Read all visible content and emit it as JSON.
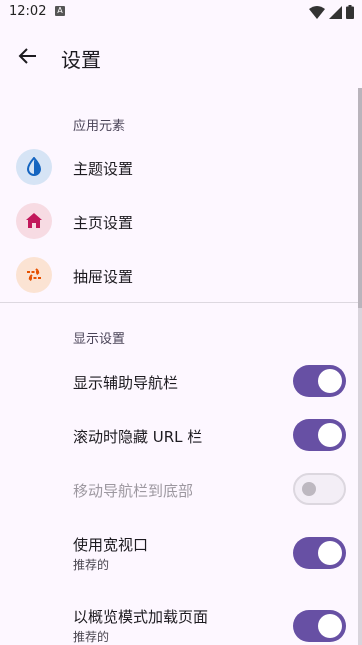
{
  "status_bar": {
    "time": "12:02",
    "notification_letter": "A",
    "icons": [
      "wifi-icon",
      "cellular-signal-icon",
      "battery-icon"
    ]
  },
  "app_bar": {
    "title": "设置",
    "back_icon": "arrow-back-icon"
  },
  "sections": [
    {
      "title": "应用元素",
      "items": [
        {
          "label": "主题设置",
          "icon": "water-drop-icon",
          "icon_color": "#1565c0",
          "icon_bg": "#d6e4f5"
        },
        {
          "label": "主页设置",
          "icon": "home-icon",
          "icon_color": "#c2185b",
          "icon_bg": "#f7dbe3"
        },
        {
          "label": "抽屉设置",
          "icon": "swap-arrows-icon",
          "icon_color": "#e65100",
          "icon_bg": "#fbe3d3"
        }
      ]
    },
    {
      "title": "显示设置",
      "items": [
        {
          "label": "显示辅助导航栏",
          "subtitle": "",
          "enabled": true,
          "checked": true
        },
        {
          "label": "滚动时隐藏 URL 栏",
          "subtitle": "",
          "enabled": true,
          "checked": true
        },
        {
          "label": "移动导航栏到底部",
          "subtitle": "",
          "enabled": false,
          "checked": false
        },
        {
          "label": "使用宽视口",
          "subtitle": "推荐的",
          "enabled": true,
          "checked": true
        },
        {
          "label": "以概览模式加载页面",
          "subtitle": "推荐的",
          "enabled": true,
          "checked": true
        }
      ]
    }
  ],
  "colors": {
    "accent": "#6750a4",
    "background": "#fdf7ff"
  }
}
